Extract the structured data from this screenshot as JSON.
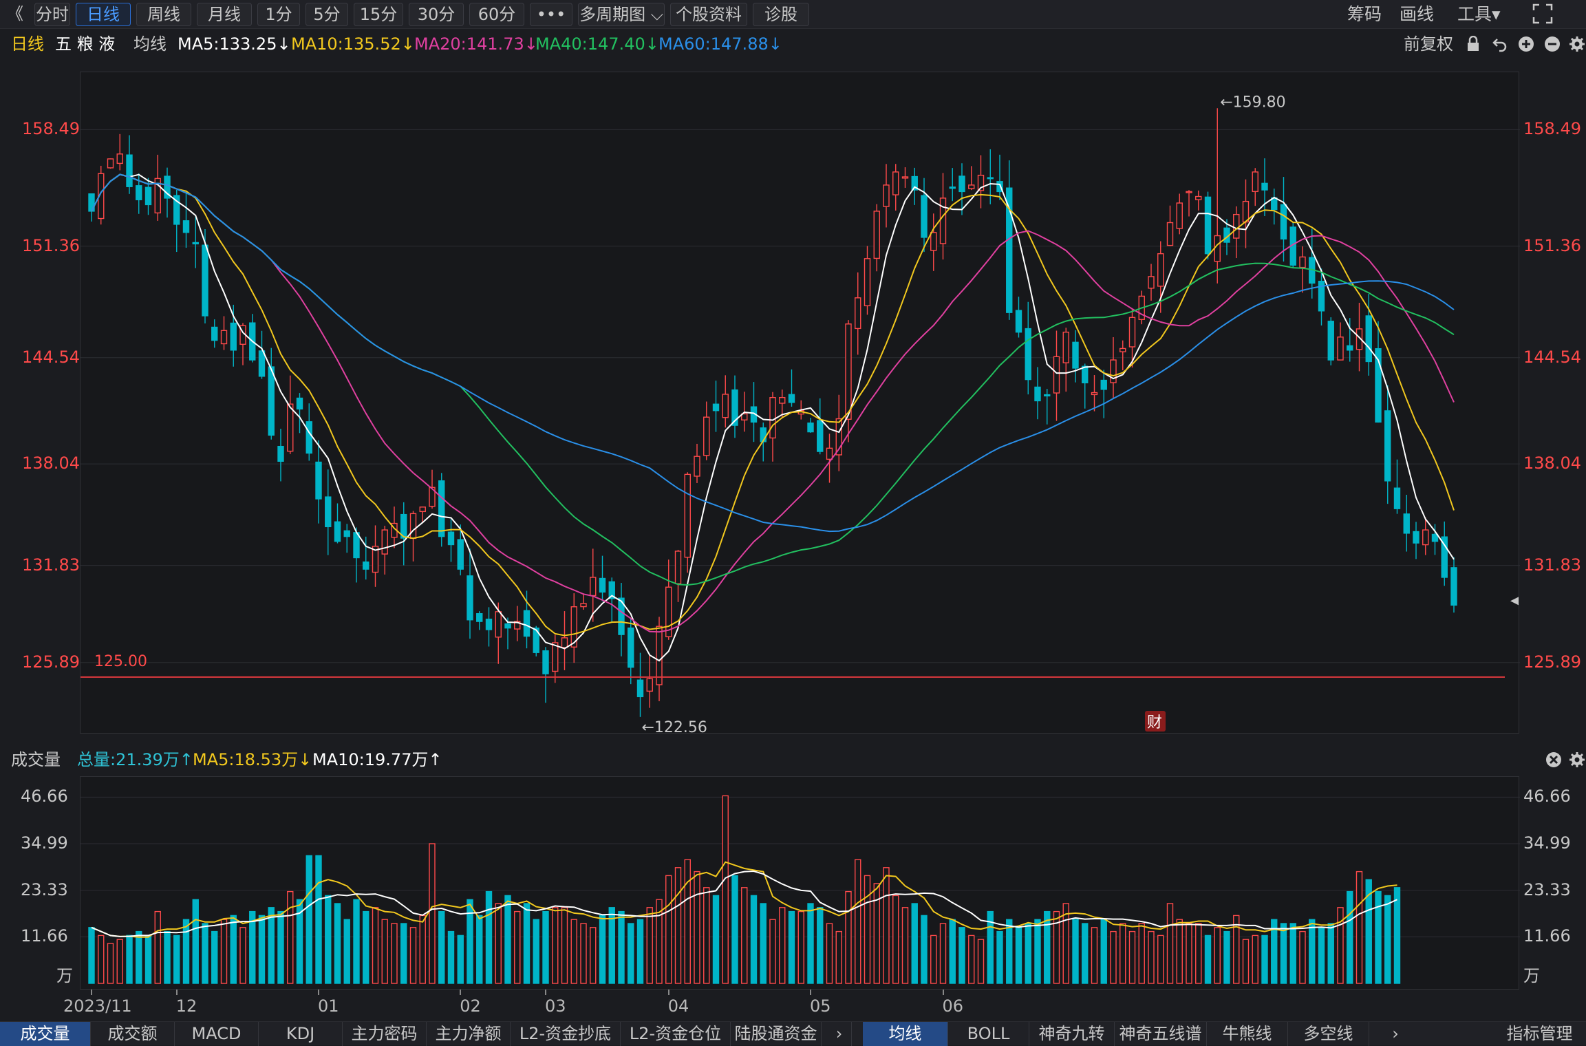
{
  "toolbar": {
    "back": "《",
    "tabs": [
      "分时",
      "日线",
      "周线",
      "月线",
      "1分",
      "5分",
      "15分",
      "30分",
      "60分",
      "•••",
      "多周期图 ⌵",
      "个股资料",
      "诊股"
    ],
    "right": [
      "筹码",
      "画线",
      "工具▾"
    ]
  },
  "info": {
    "period": "日线",
    "name": "五 粮 液",
    "ma_label": "均线",
    "ma5": "MA5:133.25↓",
    "ma10": "MA10:135.52↓",
    "ma20": "MA20:141.73↓",
    "ma40": "MA40:147.40↓",
    "ma60": "MA60:147.88↓",
    "fuquan": "前复权"
  },
  "price_axis": [
    "158.49",
    "151.36",
    "144.54",
    "138.04",
    "131.83",
    "125.89"
  ],
  "annotations": {
    "high": "←159.80",
    "low": "←122.56",
    "line": "125.00",
    "cai": "财"
  },
  "volume": {
    "title": "成交量",
    "total": "总量:21.39万↑",
    "ma5": "MA5:18.53万↓",
    "ma10": "MA10:19.77万↑",
    "axis": [
      "46.66",
      "34.99",
      "23.33",
      "11.66",
      "万"
    ]
  },
  "x_axis": [
    "2023/11",
    "12",
    "01",
    "02",
    "03",
    "04",
    "05",
    "06"
  ],
  "bottom_tabs_left": [
    "成交量",
    "成交额",
    "MACD",
    "KDJ",
    "主力密码",
    "主力净额",
    "L2-资金抄底",
    "L2-资金仓位",
    "陆股通资金"
  ],
  "bottom_tabs_right": [
    "均线",
    "BOLL",
    "神奇九转",
    "神奇五线谱",
    "牛熊线",
    "多空线"
  ],
  "indicator_manage": "指标管理",
  "colors": {
    "up": "#ff4a4a",
    "down": "#00b5c8",
    "ma5": "#ffffff",
    "ma10": "#f2c81e",
    "ma20": "#e040a0",
    "ma40": "#22c060",
    "ma60": "#2a8fe8"
  },
  "chart_data": {
    "type": "candlestick",
    "closes": [
      153.5,
      155.8,
      156.7,
      157.0,
      155.0,
      154.2,
      153.9,
      155.5,
      154.3,
      152.7,
      152.2,
      151.5,
      147.1,
      145.6,
      146.2,
      145.0,
      146.5,
      144.4,
      143.4,
      139.8,
      138.2,
      141.7,
      141.4,
      138.7,
      135.9,
      134.2,
      133.3,
      133.6,
      132.3,
      131.6,
      133.0,
      134.0,
      134.4,
      133.5,
      135.0,
      135.4,
      136.6,
      133.6,
      133.1,
      131.6,
      128.5,
      128.4,
      127.9,
      129.0,
      128.0,
      128.4,
      127.5,
      126.5,
      125.2,
      127.1,
      127.4,
      129.3,
      129.5,
      131.1,
      130.2,
      129.8,
      127.6,
      125.6,
      123.8,
      124.9,
      128.1,
      130.5,
      132.7,
      137.4,
      138.5,
      140.9,
      141.3,
      142.3,
      140.4,
      141.1,
      140.6,
      139.4,
      142.1,
      142.1,
      141.8,
      141.3,
      140.0,
      138.8,
      139.0,
      140.8,
      146.6,
      148.2,
      150.6,
      153.5,
      155.1,
      155.9,
      155.6,
      154.8,
      151.9,
      152.2,
      154.3,
      154.9,
      154.7,
      155.1,
      155.7,
      155.5,
      154.7,
      147.3,
      146.1,
      143.2,
      141.9,
      142.2,
      144.6,
      146.1,
      143.9,
      143.0,
      142.4,
      142.6,
      144.4,
      145.1,
      147.0,
      148.3,
      149.5,
      150.9,
      152.8,
      154.0,
      154.7,
      154.4,
      150.9,
      152.0,
      151.6,
      153.3,
      154.1,
      155.9,
      154.8,
      153.6,
      151.8,
      150.2,
      150.7,
      149.1,
      147.4,
      144.4,
      145.8,
      145.0,
      146.3,
      144.3,
      140.6,
      137.0,
      135.3,
      133.8,
      133.2,
      134.0,
      133.3,
      131.1,
      129.4
    ],
    "candle_count": 139,
    "price_range": [
      121.5,
      162.0
    ],
    "marked_high": 159.8,
    "marked_low": 122.56,
    "reference_line": 125.0,
    "ma_series": [
      "MA5",
      "MA10",
      "MA20",
      "MA40",
      "MA60"
    ],
    "volumes": [
      14,
      12,
      10,
      11,
      12,
      13,
      12,
      18,
      13,
      12,
      16,
      21,
      15,
      13,
      16,
      17,
      14,
      18,
      17,
      19,
      18,
      23,
      21,
      32,
      32,
      22,
      20,
      16,
      21,
      18,
      19,
      16,
      15,
      15,
      14,
      17,
      35,
      18,
      13,
      12,
      21,
      17,
      23,
      20,
      22,
      18,
      20,
      16,
      18,
      19,
      19,
      16,
      15,
      14,
      17,
      19,
      18,
      15,
      16,
      19,
      21,
      27,
      29,
      31,
      28,
      24,
      22,
      47,
      27,
      24,
      22,
      20,
      16,
      19,
      18,
      18,
      20,
      19,
      15,
      13,
      23,
      31,
      27,
      25,
      29,
      22,
      19,
      20,
      17,
      12,
      15,
      16,
      14,
      12,
      11,
      18,
      13,
      16,
      14,
      15,
      16,
      18,
      18,
      20,
      16,
      15,
      14,
      16,
      13,
      15,
      13,
      15,
      13,
      12,
      20,
      16,
      15,
      15,
      12,
      14,
      13,
      17,
      11,
      12,
      12,
      16,
      15,
      15,
      13,
      16,
      14,
      15,
      19,
      23,
      28,
      26,
      23,
      22,
      24
    ],
    "volume_range": [
      0,
      50
    ],
    "volume_ma5": "18.53万",
    "volume_ma10": "19.77万"
  }
}
